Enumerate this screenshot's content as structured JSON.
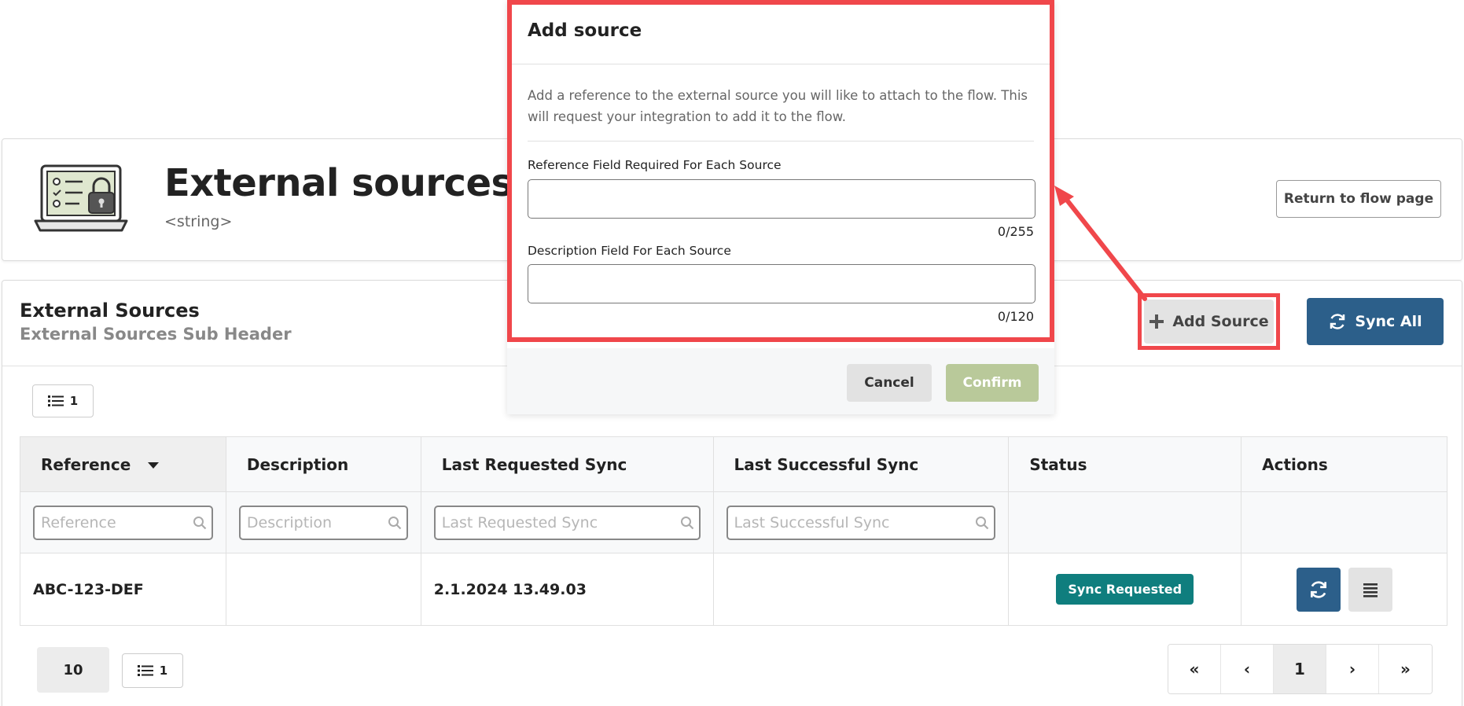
{
  "header": {
    "title": "External sources",
    "subtitle": "<string>",
    "return_label": "Return to flow page"
  },
  "section": {
    "title": "External Sources",
    "subtitle": "External Sources Sub Header",
    "add_source_label": "Add Source",
    "sync_all_label": "Sync All"
  },
  "toolbar": {
    "count": "1"
  },
  "table": {
    "columns": [
      "Reference",
      "Description",
      "Last Requested Sync",
      "Last Successful Sync",
      "Status",
      "Actions"
    ],
    "filters": {
      "reference": "Reference",
      "description": "Description",
      "last_requested": "Last Requested Sync",
      "last_successful": "Last Successful Sync"
    },
    "rows": [
      {
        "reference": "ABC-123-DEF",
        "description": "",
        "last_requested": "2.1.2024 13.49.03",
        "last_successful": "",
        "status": "Sync Requested"
      }
    ]
  },
  "footer": {
    "page_size": "10",
    "count": "1",
    "pager": {
      "first": "«",
      "prev": "‹",
      "current": "1",
      "next": "›",
      "last": "»"
    }
  },
  "modal": {
    "title": "Add source",
    "description": "Add a reference to the external source you will like to attach to the flow. This will request your integration to add it to the flow.",
    "reference_label": "Reference Field Required For Each Source",
    "reference_counter": "0/255",
    "description_label": "Description Field For Each Source",
    "description_counter": "0/120",
    "cancel_label": "Cancel",
    "confirm_label": "Confirm"
  },
  "colors": {
    "primary": "#2c5f8a",
    "status_badge": "#0f7e7e",
    "confirm_disabled": "#b9c99a",
    "highlight": "#f0474b"
  },
  "icons": [
    "laptop-lock-illustration",
    "plus-icon",
    "sync-icon",
    "list-icon",
    "search-icon",
    "menu-icon",
    "sort-caret-icon"
  ]
}
